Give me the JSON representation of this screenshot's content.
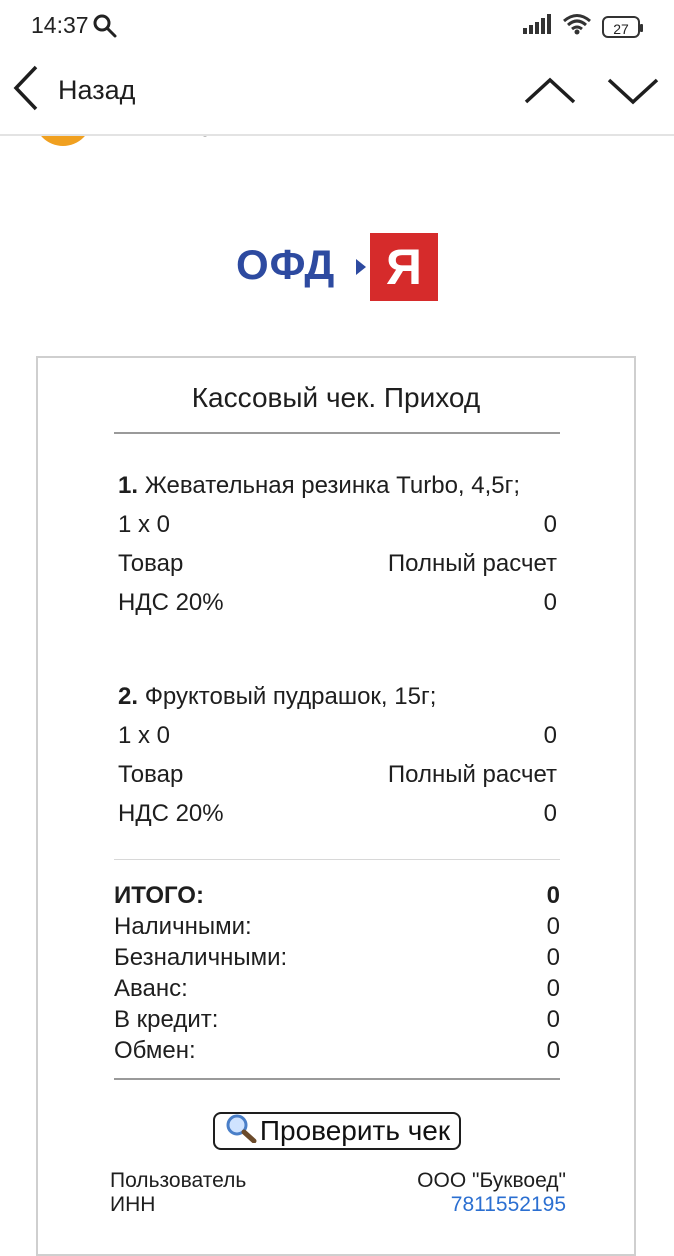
{
  "status_bar": {
    "time": "14:37",
    "battery": "27",
    "icons": [
      "search-icon",
      "signal-icon",
      "wifi-icon",
      "battery-icon"
    ]
  },
  "nav": {
    "back_label": "Назад",
    "icons": [
      "chevron-left-icon",
      "chevron-up-icon",
      "chevron-down-icon"
    ]
  },
  "logo": {
    "text": "ОФД",
    "mark": "Я",
    "colors": {
      "text": "#2d4aa0",
      "box": "#d62b2b"
    }
  },
  "receipt": {
    "title": "Кассовый чек. Приход",
    "items": [
      {
        "number": "1.",
        "name": "Жевательная резинка Turbo, 4,5г;",
        "qty_price": "1 x 0",
        "sum": "0",
        "type": "Товар",
        "payment_method": "Полный расчет",
        "vat_label": "НДС 20%",
        "vat_value": "0"
      },
      {
        "number": "2.",
        "name": "Фруктовый пудрашок, 15г;",
        "qty_price": "1 x 0",
        "sum": "0",
        "type": "Товар",
        "payment_method": "Полный расчет",
        "vat_label": "НДС 20%",
        "vat_value": "0"
      }
    ],
    "totals": [
      {
        "label": "ИТОГО:",
        "value": "0"
      },
      {
        "label": "Наличными:",
        "value": "0"
      },
      {
        "label": "Безналичными:",
        "value": "0"
      },
      {
        "label": "Аванс:",
        "value": "0"
      },
      {
        "label": "В кредит:",
        "value": "0"
      },
      {
        "label": "Обмен:",
        "value": "0"
      }
    ],
    "verify_button": "Проверить чек",
    "footer": {
      "user_label": "Пользователь",
      "user_value": "ООО \"Буквоед\"",
      "inn_label": "ИНН",
      "inn_value": "7811552195"
    }
  }
}
